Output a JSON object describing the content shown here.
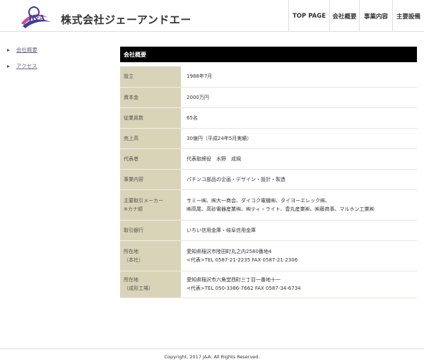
{
  "brand": {
    "name": "株式会社ジェーアンドエー",
    "logo_letters": "J&A",
    "colors": {
      "blue": "#3c3c9a",
      "pink": "#d04a93",
      "dark": "#333333"
    }
  },
  "nav": [
    "TOP PAGE",
    "会社概要",
    "事業内容",
    "主要設備"
  ],
  "sidebar": [
    {
      "label": "会社概要"
    },
    {
      "label": "アクセス"
    }
  ],
  "main": {
    "title": "会社概要",
    "rows": [
      {
        "key": [
          "設立"
        ],
        "value": [
          "1988年7月"
        ]
      },
      {
        "key": [
          "資本金"
        ],
        "value": [
          "2000万円"
        ]
      },
      {
        "key": [
          "従業員数"
        ],
        "value": [
          "65名"
        ]
      },
      {
        "key": [
          "売上高"
        ],
        "value": [
          "30億円（平成24年5月実績）"
        ]
      },
      {
        "key": [
          "代表者"
        ],
        "value": [
          "代表取締役　水野　成規"
        ]
      },
      {
        "key": [
          "事業内容"
        ],
        "value": [
          "パチンコ部品の企画・デザイン・設計・製造"
        ]
      },
      {
        "key": [
          "主要取引メーカー",
          "※カナ順"
        ],
        "value": [
          "サミー㈱、㈱大一商会、ダイコク電機㈱、タイヨーエレック㈱、",
          "㈱高尾、高砂電器産業㈱、㈱ティ・ライト、豊丸産業㈱、㈱藤商事、マルホン工業㈱"
        ]
      },
      {
        "key": [
          "取引銀行"
        ],
        "value": [
          "いちい信用金庫・岐阜信用金庫"
        ]
      },
      {
        "key": [
          "所在地",
          "（本社）"
        ],
        "value": [
          "愛知県稲沢市陸田町丸之内2580番地4",
          "<代表>TEL 0587-21-2235 FAX 0587-21-2306"
        ]
      },
      {
        "key": [
          "所在地",
          "（成形工場）"
        ],
        "value": [
          "愛知県稲沢市六角堂西町三丁目一番地十一",
          "<代表>TEL 050-3386-7662 FAX 0587-34-6734"
        ]
      }
    ]
  },
  "footer": {
    "copyright": "Copyright, 2017 J&A. All Rights Reserved."
  }
}
